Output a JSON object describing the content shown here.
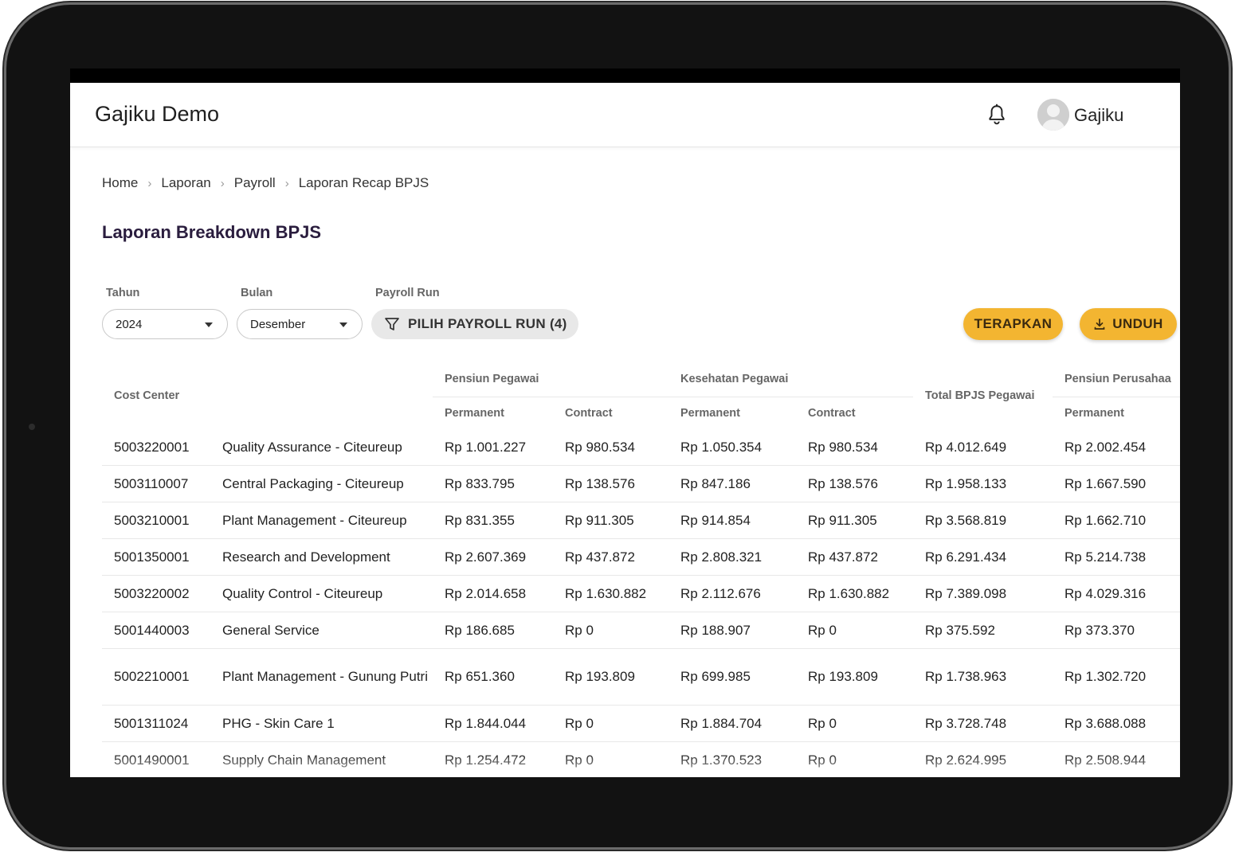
{
  "app": {
    "title": "Gajiku Demo",
    "user_name": "Gajiku"
  },
  "breadcrumb": {
    "items": [
      "Home",
      "Laporan",
      "Payroll",
      "Laporan Recap BPJS"
    ]
  },
  "page": {
    "title": "Laporan Breakdown BPJS"
  },
  "filters": {
    "year": {
      "label": "Tahun",
      "value": "2024"
    },
    "month": {
      "label": "Bulan",
      "value": "Desember"
    },
    "payroll_run": {
      "label": "Payroll Run",
      "button": "PILIH PAYROLL RUN (4)"
    }
  },
  "actions": {
    "apply": "TERAPKAN",
    "download": "UNDUH"
  },
  "colors": {
    "accent": "#f3b531",
    "title": "#2a1d3e"
  },
  "table": {
    "headers": {
      "cost_center": "Cost Center",
      "pensiun_pegawai": "Pensiun Pegawai",
      "kesehatan_pegawai": "Kesehatan Pegawai",
      "total_bpjs_pegawai": "Total BPJS Pegawai",
      "pensiun_perusahaan": "Pensiun Perusahaa",
      "permanent": "Permanent",
      "contract": "Contract"
    },
    "rows": [
      {
        "code": "5003220001",
        "name": "Quality Assurance - Citeureup",
        "pp_perm": "Rp 1.001.227",
        "pp_cont": "Rp 980.534",
        "kp_perm": "Rp 1.050.354",
        "kp_cont": "Rp 980.534",
        "total": "Rp 4.012.649",
        "ppr_perm": "Rp 2.002.454"
      },
      {
        "code": "5003110007",
        "name": "Central Packaging - Citeureup",
        "pp_perm": "Rp 833.795",
        "pp_cont": "Rp 138.576",
        "kp_perm": "Rp 847.186",
        "kp_cont": "Rp 138.576",
        "total": "Rp 1.958.133",
        "ppr_perm": "Rp 1.667.590"
      },
      {
        "code": "5003210001",
        "name": "Plant Management - Citeureup",
        "pp_perm": "Rp 831.355",
        "pp_cont": "Rp 911.305",
        "kp_perm": "Rp 914.854",
        "kp_cont": "Rp 911.305",
        "total": "Rp 3.568.819",
        "ppr_perm": "Rp 1.662.710"
      },
      {
        "code": "5001350001",
        "name": "Research and Development",
        "pp_perm": "Rp 2.607.369",
        "pp_cont": "Rp 437.872",
        "kp_perm": "Rp 2.808.321",
        "kp_cont": "Rp 437.872",
        "total": "Rp 6.291.434",
        "ppr_perm": "Rp 5.214.738"
      },
      {
        "code": "5003220002",
        "name": "Quality Control - Citeureup",
        "pp_perm": "Rp 2.014.658",
        "pp_cont": "Rp 1.630.882",
        "kp_perm": "Rp 2.112.676",
        "kp_cont": "Rp 1.630.882",
        "total": "Rp 7.389.098",
        "ppr_perm": "Rp 4.029.316"
      },
      {
        "code": "5001440003",
        "name": "General Service",
        "pp_perm": "Rp 186.685",
        "pp_cont": "Rp 0",
        "kp_perm": "Rp 188.907",
        "kp_cont": "Rp 0",
        "total": "Rp 375.592",
        "ppr_perm": "Rp 373.370"
      },
      {
        "code": "5002210001",
        "name": "Plant Management - Gunung Putri",
        "pp_perm": "Rp 651.360",
        "pp_cont": "Rp 193.809",
        "kp_perm": "Rp 699.985",
        "kp_cont": "Rp 193.809",
        "total": "Rp 1.738.963",
        "ppr_perm": "Rp 1.302.720"
      },
      {
        "code": "5001311024",
        "name": "PHG - Skin Care 1",
        "pp_perm": "Rp 1.844.044",
        "pp_cont": "Rp 0",
        "kp_perm": "Rp 1.884.704",
        "kp_cont": "Rp 0",
        "total": "Rp 3.728.748",
        "ppr_perm": "Rp 3.688.088"
      },
      {
        "code": "5001490001",
        "name": "Supply Chain Management",
        "pp_perm": "Rp 1.254.472",
        "pp_cont": "Rp 0",
        "kp_perm": "Rp 1.370.523",
        "kp_cont": "Rp 0",
        "total": "Rp 2.624.995",
        "ppr_perm": "Rp 2.508.944"
      }
    ]
  }
}
